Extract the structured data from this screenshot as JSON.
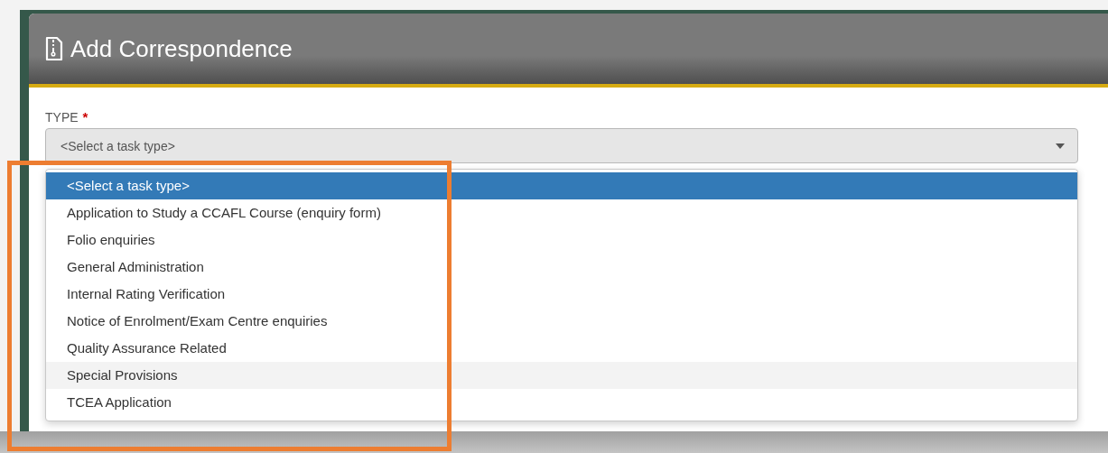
{
  "dialog": {
    "title": "Add Correspondence"
  },
  "type_field": {
    "label": "TYPE",
    "required_mark": "*",
    "value": "<Select a task type>"
  },
  "options": [
    {
      "label": "<Select a task type>",
      "selected": true,
      "hovered": false
    },
    {
      "label": "Application to Study a CCAFL Course (enquiry form)",
      "selected": false,
      "hovered": false
    },
    {
      "label": "Folio enquiries",
      "selected": false,
      "hovered": false
    },
    {
      "label": "General Administration",
      "selected": false,
      "hovered": false
    },
    {
      "label": "Internal Rating Verification",
      "selected": false,
      "hovered": false
    },
    {
      "label": "Notice of Enrolment/Exam Centre enquiries",
      "selected": false,
      "hovered": false
    },
    {
      "label": "Quality Assurance Related",
      "selected": false,
      "hovered": false
    },
    {
      "label": "Special Provisions",
      "selected": false,
      "hovered": true
    },
    {
      "label": "TCEA Application",
      "selected": false,
      "hovered": false
    }
  ],
  "annotation": {
    "kind": "frame",
    "color": "#ed7d31"
  }
}
